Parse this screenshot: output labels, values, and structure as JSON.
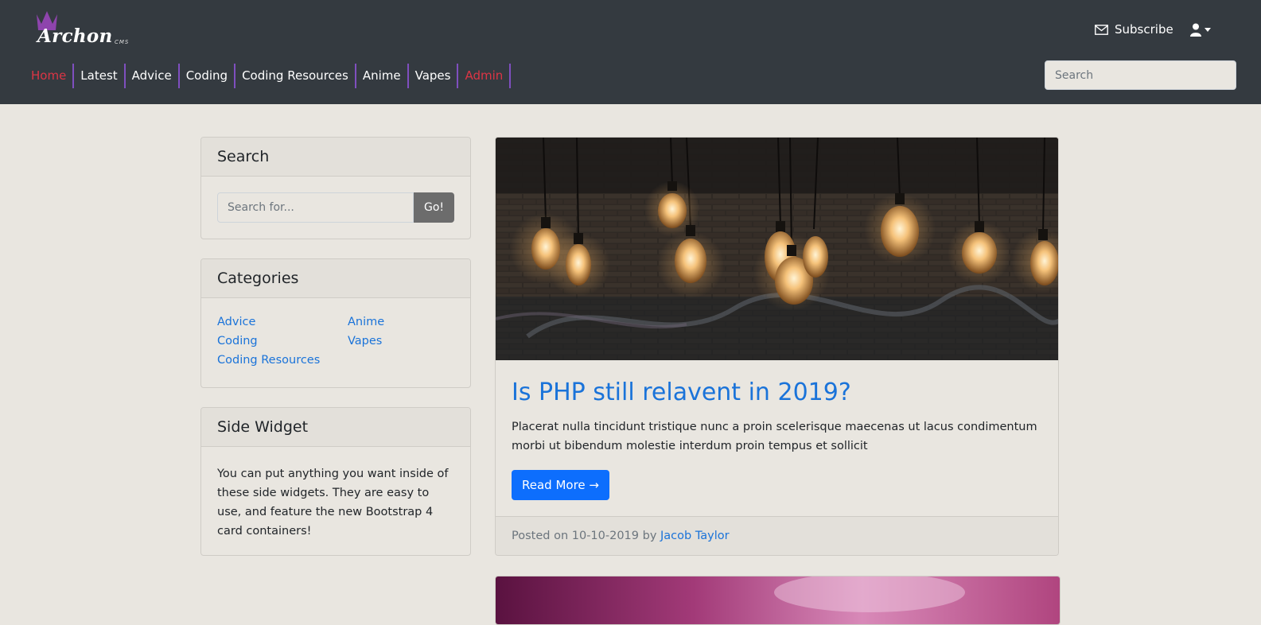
{
  "brand": {
    "name": "Archon",
    "suffix": "CMS"
  },
  "header": {
    "subscribe_label": "Subscribe",
    "search_placeholder": "Search",
    "nav": [
      {
        "label": "Home"
      },
      {
        "label": "Latest"
      },
      {
        "label": "Advice"
      },
      {
        "label": "Coding"
      },
      {
        "label": "Coding Resources"
      },
      {
        "label": "Anime"
      },
      {
        "label": "Vapes"
      },
      {
        "label": "Admin"
      }
    ]
  },
  "sidebar": {
    "search": {
      "title": "Search",
      "placeholder": "Search for...",
      "button_label": "Go!"
    },
    "categories": {
      "title": "Categories",
      "items": [
        "Advice",
        "Anime",
        "Coding",
        "Vapes",
        "Coding Resources"
      ]
    },
    "widget": {
      "title": "Side Widget",
      "text": "You can put anything you want inside of these side widgets. They are easy to use, and feature the new Bootstrap 4 card containers!"
    }
  },
  "post": {
    "title": "Is PHP still relavent in 2019?",
    "excerpt": "Placerat nulla tincidunt tristique nunc a proin scelerisque maecenas ut lacus condimentum morbi ut bibendum molestie interdum proin tempus et sollicit",
    "read_more_label": "Read More →",
    "posted_prefix": "Posted on 10-10-2019 by",
    "author": "Jacob Taylor"
  },
  "colors": {
    "header_bg": "#343a40",
    "nav_separator": "#7f4fbf",
    "nav_active": "#dc3545",
    "link": "#1a73d9",
    "primary_button": "#0d6efd",
    "page_bg": "#e9e6e0"
  },
  "icons": {
    "subscribe": "envelope-icon",
    "user": "user-icon",
    "logo": "crown-icon"
  }
}
